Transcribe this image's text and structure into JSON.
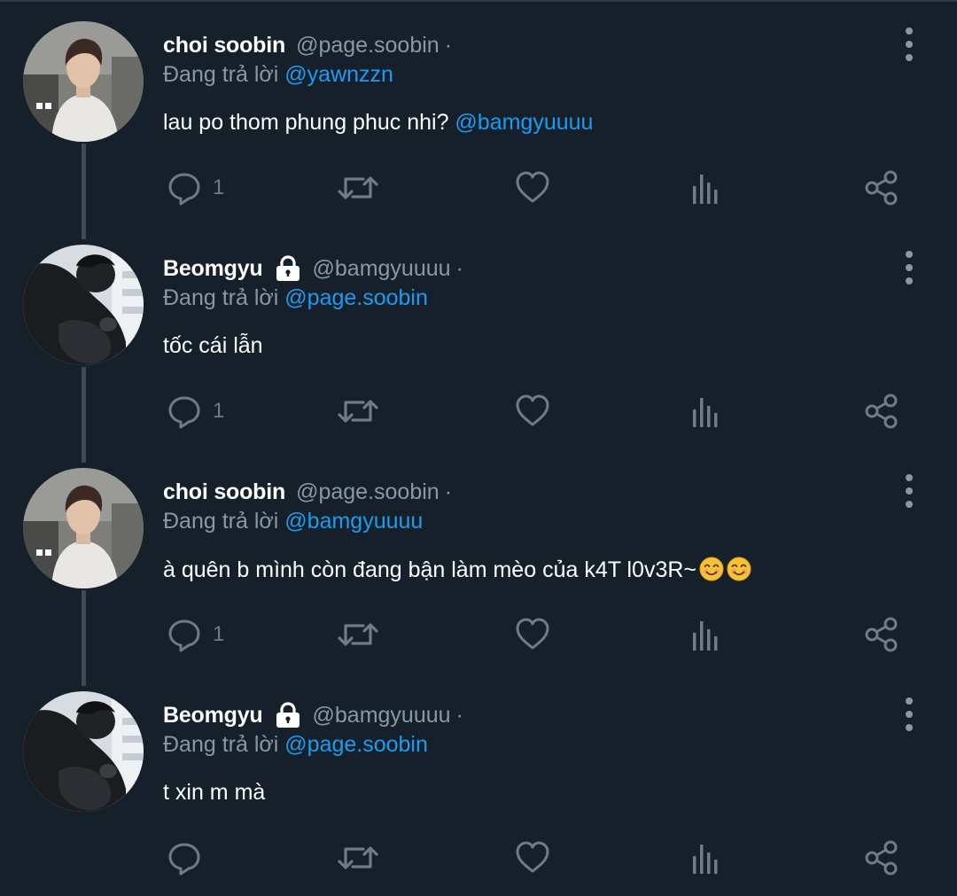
{
  "tweets": [
    {
      "name": "choi soobin",
      "handle": "@page.soobin",
      "dot": "·",
      "protected": false,
      "reply_prefix": "Đang trả lời ",
      "reply_to": "@yawnzzn",
      "text": "lau po thom phung phuc nhi? ",
      "text_mention": "@bamgyuuuu",
      "emojis": 0,
      "reply_count": "1",
      "avatar": "soobin"
    },
    {
      "name": "Beomgyu",
      "handle": "@bamgyuuuu",
      "dot": "·",
      "protected": true,
      "reply_prefix": "Đang trả lời ",
      "reply_to": "@page.soobin",
      "text": "tốc cái lẫn",
      "text_mention": "",
      "emojis": 0,
      "reply_count": "1",
      "avatar": "beomgyu"
    },
    {
      "name": "choi soobin",
      "handle": "@page.soobin",
      "dot": "·",
      "protected": false,
      "reply_prefix": "Đang trả lời ",
      "reply_to": "@bamgyuuuu",
      "text": "à quên b mình còn đang bận làm mèo của k4T l0v3R~",
      "text_mention": "",
      "emojis": 2,
      "reply_count": "1",
      "avatar": "soobin"
    },
    {
      "name": "Beomgyu",
      "handle": "@bamgyuuuu",
      "dot": "·",
      "protected": true,
      "reply_prefix": "Đang trả lời ",
      "reply_to": "@page.soobin",
      "text": "t xin m mà",
      "text_mention": "",
      "emojis": 0,
      "reply_count": "",
      "avatar": "beomgyu"
    }
  ],
  "icons": {
    "more": "more-vertical-icon",
    "lock": "lock-icon",
    "reply": "reply-icon",
    "retweet": "retweet-icon",
    "like": "heart-icon",
    "views": "analytics-icon",
    "share": "share-icon",
    "emoji": "smiling-face-emoji"
  },
  "colors": {
    "background": "#15202b",
    "name": "#ffffff",
    "secondary": "#8899a6",
    "mention": "#1d9bf0",
    "icon": "#6e7b88",
    "thread_line": "#3d4956"
  }
}
